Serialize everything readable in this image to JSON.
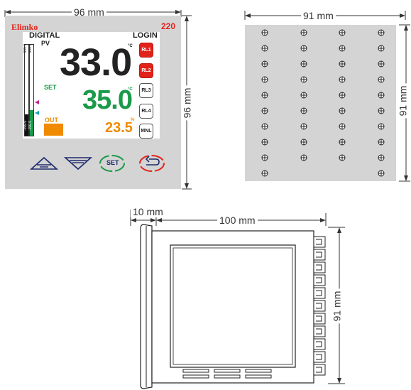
{
  "front": {
    "width_label": "96 mm",
    "height_label": "96 mm",
    "brand": "Elimko",
    "model": "220",
    "mode_label": "DIGITAL",
    "login_label": "LOGIN",
    "pv_label": "PV",
    "pv_value": "33.0",
    "pv_unit": "°C",
    "set_label": "SET",
    "set_value": "35.0",
    "set_unit": "°C",
    "out_label": "OUT",
    "out_value": "23.5",
    "out_unit": "%",
    "bar_top_1": "999.9",
    "bar_top_2": "999.9",
    "bar_bottom_1": "-199.9",
    "bar_bottom_2": "-199.9",
    "relays": [
      {
        "label": "RL1",
        "state": "on"
      },
      {
        "label": "RL2",
        "state": "on"
      },
      {
        "label": "RL3",
        "state": "off"
      },
      {
        "label": "RL4",
        "state": "off"
      },
      {
        "label": "MNL",
        "state": "off"
      }
    ],
    "buttons": [
      {
        "icon": "up-arrow-icon"
      },
      {
        "icon": "down-arrow-icon"
      },
      {
        "icon": "set-button-icon",
        "label": "SET"
      },
      {
        "icon": "return-icon"
      }
    ],
    "colors": {
      "red": "#e2231a",
      "green": "#1a9a4a",
      "orange": "#f08a00",
      "bezel": "#d4d4d4"
    }
  },
  "cutout": {
    "width_label": "91 mm",
    "height_label": "91 mm"
  },
  "side": {
    "bezel_label": "10 mm",
    "depth_label": "100 mm",
    "height_label": "91 mm"
  }
}
